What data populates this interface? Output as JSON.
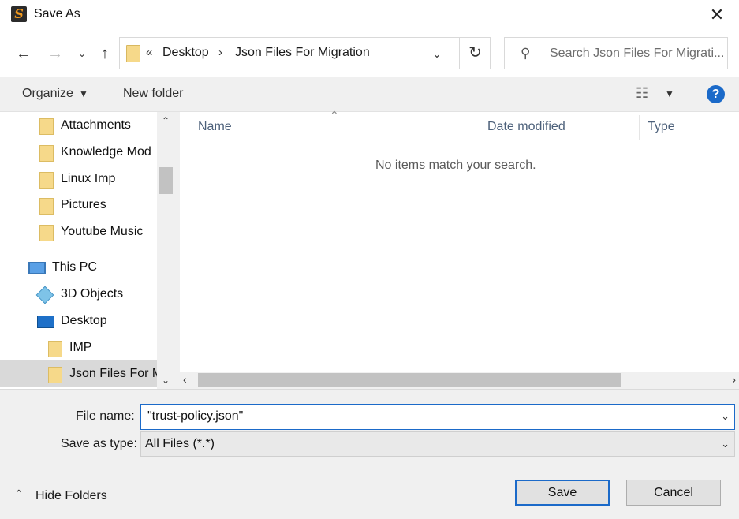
{
  "window": {
    "title": "Save As"
  },
  "nav": {
    "breadcrumb_prefix": "«",
    "breadcrumb": [
      "Desktop",
      "Json Files For Migration"
    ],
    "search_placeholder": "Search Json Files For Migrati..."
  },
  "toolbar": {
    "organize": "Organize",
    "new_folder": "New folder",
    "help": "?"
  },
  "sidebar": {
    "items": [
      {
        "label": "Attachments",
        "icon": "folder-icon"
      },
      {
        "label": "Knowledge Mod",
        "icon": "folder-icon"
      },
      {
        "label": "Linux Imp",
        "icon": "folder-icon"
      },
      {
        "label": "Pictures",
        "icon": "folder-icon"
      },
      {
        "label": "Youtube Music",
        "icon": "folder-icon"
      },
      {
        "label": "This PC",
        "icon": "pc-icon"
      },
      {
        "label": "3D Objects",
        "icon": "3d-objects-icon"
      },
      {
        "label": "Desktop",
        "icon": "desktop-icon"
      },
      {
        "label": "IMP",
        "icon": "folder-icon"
      },
      {
        "label": "Json Files For M",
        "icon": "folder-icon"
      }
    ]
  },
  "files": {
    "columns": [
      "Name",
      "Date modified",
      "Type"
    ],
    "empty_message": "No items match your search."
  },
  "form": {
    "file_name_label": "File name:",
    "file_name_value": "\"trust-policy.json\"",
    "save_type_label": "Save as type:",
    "save_type_value": "All Files (*.*)"
  },
  "footer": {
    "hide_folders": "Hide Folders",
    "save": "Save",
    "cancel": "Cancel"
  },
  "colors": {
    "accent": "#1b6ac9",
    "folder": "#f6d98a"
  }
}
